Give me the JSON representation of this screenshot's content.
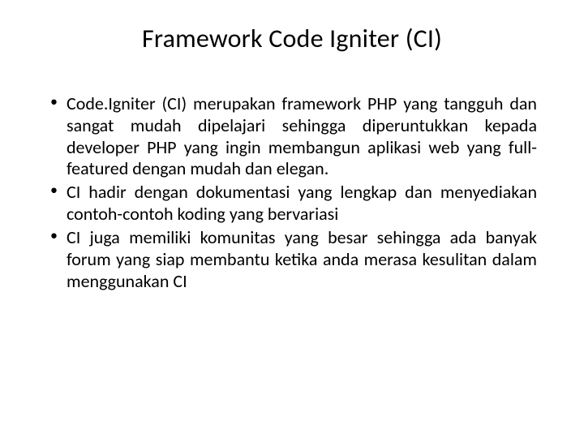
{
  "slide": {
    "title": "Framework Code Igniter (CI)",
    "bullets": [
      "Code.Igniter (CI) merupakan framework PHP yang tangguh dan sangat mudah dipelajari sehingga diperuntukkan kepada developer PHP yang ingin membangun aplikasi web yang full-featured dengan mudah dan elegan.",
      "CI hadir dengan dokumentasi yang lengkap dan menyediakan contoh-contoh koding yang bervariasi",
      "CI juga memiliki komunitas yang besar sehingga ada banyak forum yang siap membantu ketika anda merasa kesulitan dalam menggunakan CI"
    ]
  }
}
